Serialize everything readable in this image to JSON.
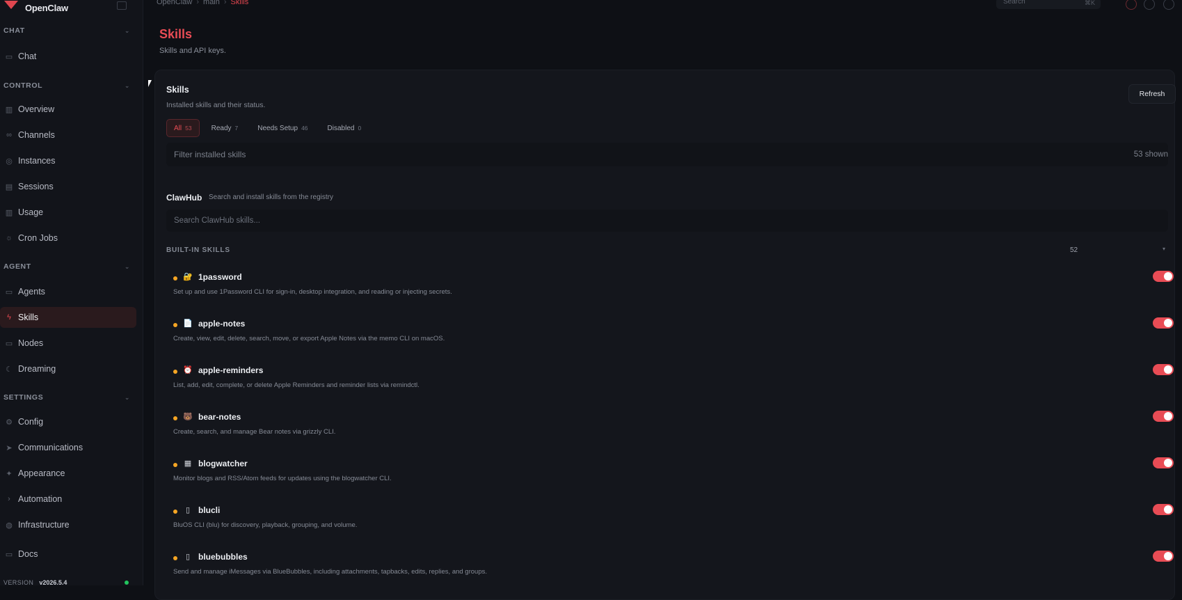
{
  "app": {
    "name": "OpenClaw",
    "version_label": "VERSION",
    "version": "v2026.5.4"
  },
  "breadcrumb": [
    "OpenClaw",
    "main",
    "Skills"
  ],
  "top_search": {
    "placeholder": "Search",
    "shortcut": "⌘K"
  },
  "sidebar": {
    "sections": [
      {
        "title": "CHAT",
        "items": [
          {
            "label": "Chat",
            "icon": "chat-icon"
          }
        ]
      },
      {
        "title": "CONTROL",
        "items": [
          {
            "label": "Overview",
            "icon": "bar-chart-icon"
          },
          {
            "label": "Channels",
            "icon": "link-icon"
          },
          {
            "label": "Instances",
            "icon": "broadcast-icon"
          },
          {
            "label": "Sessions",
            "icon": "document-icon"
          },
          {
            "label": "Usage",
            "icon": "bar-chart-icon"
          },
          {
            "label": "Cron Jobs",
            "icon": "sun-icon"
          }
        ]
      },
      {
        "title": "AGENT",
        "items": [
          {
            "label": "Agents",
            "icon": "folder-icon"
          },
          {
            "label": "Skills",
            "icon": "lightning-icon",
            "active": true
          },
          {
            "label": "Nodes",
            "icon": "monitor-icon"
          },
          {
            "label": "Dreaming",
            "icon": "moon-icon"
          }
        ]
      },
      {
        "title": "SETTINGS",
        "items": [
          {
            "label": "Config",
            "icon": "gear-icon"
          },
          {
            "label": "Communications",
            "icon": "send-icon"
          },
          {
            "label": "Appearance",
            "icon": "sparkle-icon"
          },
          {
            "label": "Automation",
            "icon": "terminal-icon"
          },
          {
            "label": "Infrastructure",
            "icon": "globe-icon"
          }
        ]
      }
    ],
    "docs": {
      "label": "Docs",
      "icon": "book-icon"
    }
  },
  "page": {
    "title": "Skills",
    "subtitle": "Skills and API keys."
  },
  "card": {
    "title": "Skills",
    "subtitle": "Installed skills and their status.",
    "refresh_label": "Refresh",
    "tabs": [
      {
        "label": "All",
        "count": "53",
        "active": true
      },
      {
        "label": "Ready",
        "count": "7"
      },
      {
        "label": "Needs Setup",
        "count": "46"
      },
      {
        "label": "Disabled",
        "count": "0"
      }
    ],
    "filter": {
      "placeholder": "Filter installed skills",
      "shown": "53 shown"
    },
    "clawhub": {
      "title": "ClawHub",
      "subtitle": "Search and install skills from the registry",
      "placeholder": "Search ClawHub skills..."
    },
    "builtin": {
      "title": "BUILT-IN SKILLS",
      "count": "52"
    },
    "skills": [
      {
        "name": "1password",
        "emoji": "🔐",
        "desc": "Set up and use 1Password CLI for sign-in, desktop integration, and reading or injecting secrets.",
        "enabled": true
      },
      {
        "name": "apple-notes",
        "emoji": "📄",
        "desc": "Create, view, edit, delete, search, move, or export Apple Notes via the memo CLI on macOS.",
        "enabled": true
      },
      {
        "name": "apple-reminders",
        "emoji": "⏰",
        "desc": "List, add, edit, complete, or delete Apple Reminders and reminder lists via remindctl.",
        "enabled": true
      },
      {
        "name": "bear-notes",
        "emoji": "🐻",
        "desc": "Create, search, and manage Bear notes via grizzly CLI.",
        "enabled": true
      },
      {
        "name": "blogwatcher",
        "emoji": "▦",
        "desc": "Monitor blogs and RSS/Atom feeds for updates using the blogwatcher CLI.",
        "enabled": true
      },
      {
        "name": "blucli",
        "emoji": "▯",
        "desc": "BluOS CLI (blu) for discovery, playback, grouping, and volume.",
        "enabled": true
      },
      {
        "name": "bluebubbles",
        "emoji": "▯",
        "desc": "Send and manage iMessages via BlueBubbles, including attachments, tapbacks, edits, replies, and groups.",
        "enabled": true
      }
    ]
  },
  "colors": {
    "accent": "#e84c55",
    "warning_dot": "#f5a524",
    "online": "#22c55e"
  }
}
